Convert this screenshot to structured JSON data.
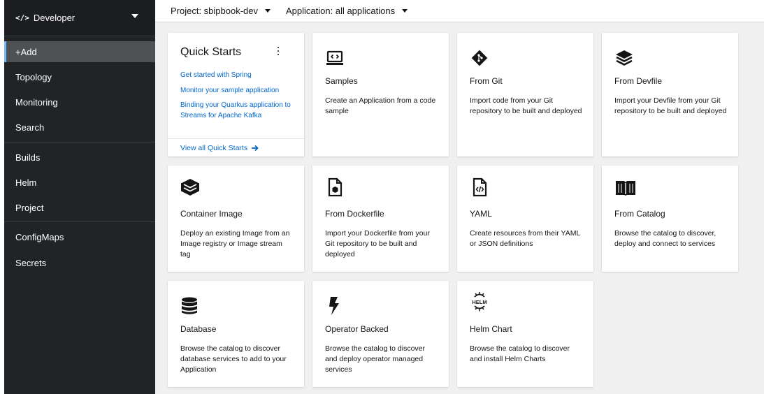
{
  "perspective": {
    "icon": "code-icon",
    "glyph": "</>",
    "label": "Developer"
  },
  "sidebar": {
    "items": [
      {
        "label": "+Add",
        "active": true
      },
      {
        "label": "Topology"
      },
      {
        "label": "Monitoring"
      },
      {
        "label": "Search"
      },
      {
        "label": "Builds"
      },
      {
        "label": "Helm"
      },
      {
        "label": "Project"
      },
      {
        "label": "ConfigMaps"
      },
      {
        "label": "Secrets"
      }
    ]
  },
  "topbar": {
    "project": "Project: sbipbook-dev",
    "application": "Application: all applications"
  },
  "quick_starts": {
    "title": "Quick Starts",
    "links": [
      "Get started with Spring",
      "Monitor your sample application",
      "Binding your Quarkus application to Streams for Apache Kafka"
    ],
    "view_all": "View all Quick Starts"
  },
  "cards": [
    {
      "icon": "laptop-code-icon",
      "title": "Samples",
      "description": "Create an Application from a code sample"
    },
    {
      "icon": "git-icon",
      "title": "From Git",
      "description": "Import code from your Git repository to be built and deployed"
    },
    {
      "icon": "layers-icon",
      "title": "From Devfile",
      "description": "Import your Devfile from your Git repository to be built and deployed"
    },
    {
      "icon": "container-layers-icon",
      "title": "Container Image",
      "description": "Deploy an existing Image from an Image registry or Image stream tag"
    },
    {
      "icon": "dockerfile-icon",
      "title": "From Dockerfile",
      "description": "Import your Dockerfile from your Git repository to be built and deployed"
    },
    {
      "icon": "yaml-file-icon",
      "title": "YAML",
      "description": "Create resources from their YAML or JSON definitions"
    },
    {
      "icon": "book-icon",
      "title": "From Catalog",
      "description": "Browse the catalog to discover, deploy and connect to services"
    },
    {
      "icon": "database-icon",
      "title": "Database",
      "description": "Browse the catalog to discover database services to add to your Application"
    },
    {
      "icon": "bolt-icon",
      "title": "Operator Backed",
      "description": "Browse the catalog to discover and deploy operator managed services"
    },
    {
      "icon": "helm-icon",
      "icon_text": "HELM",
      "title": "Helm Chart",
      "description": "Browse the catalog to discover and install Helm Charts"
    }
  ]
}
